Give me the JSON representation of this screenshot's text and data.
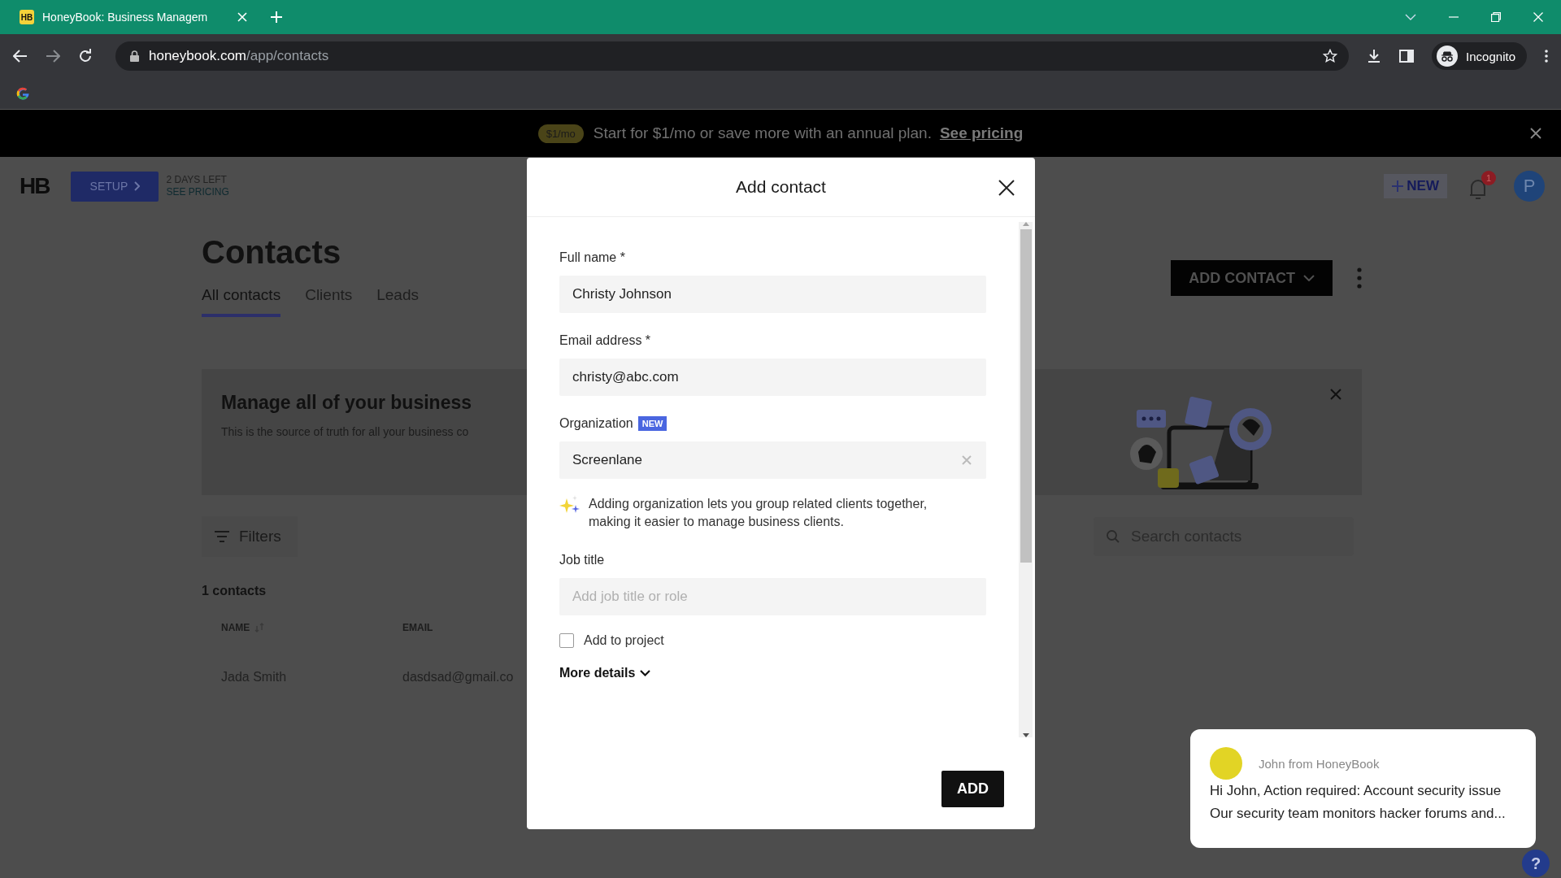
{
  "browser": {
    "favicon": "HB",
    "tab_title": "HoneyBook: Business Managem",
    "url_host": "honeybook.com",
    "url_path": "/app/contacts",
    "profile": "Incognito"
  },
  "banner": {
    "badge": "$1/mo",
    "text": "Start for $1/mo or save more with an annual plan.",
    "link": "See pricing"
  },
  "header": {
    "logo": "HB",
    "setup": "SETUP",
    "trial_days": "2 DAYS LEFT",
    "trial_link": "SEE PRICING",
    "new_button": "NEW",
    "notification_count": "1",
    "avatar_initial": "P"
  },
  "page": {
    "title": "Contacts",
    "tabs": [
      {
        "label": "All contacts",
        "selected": true
      },
      {
        "label": "Clients",
        "selected": false
      },
      {
        "label": "Leads",
        "selected": false
      }
    ],
    "add_contact": "ADD CONTACT",
    "promo": {
      "title": "Manage all of your business",
      "text": "This is the source of truth for all your business co"
    },
    "filters": "Filters",
    "search": {
      "placeholder": "Search contacts"
    },
    "count": "1 contacts",
    "table": {
      "columns": [
        "NAME",
        "EMAIL"
      ],
      "rows": [
        {
          "name": "Jada Smith",
          "email": "dasdsad@gmail.co"
        }
      ]
    }
  },
  "modal": {
    "title": "Add contact",
    "fields": [
      {
        "kind": "text",
        "label": "Full name *",
        "value": "Christy Johnson"
      },
      {
        "kind": "text",
        "label": "Email address *",
        "value": "christy@abc.com"
      },
      {
        "kind": "org",
        "label": "Organization",
        "badge": "NEW",
        "value": "Screenlane",
        "hint": "Adding organization lets you group related clients together, making it easier to manage business clients."
      },
      {
        "kind": "text",
        "label": "Job title",
        "placeholder": "Add job title or role"
      }
    ],
    "add_to_project": {
      "label": "Add to project",
      "checked": false
    },
    "more_details": "More details",
    "submit": "ADD"
  },
  "chat": {
    "sender": "John from HoneyBook",
    "lines": [
      "Hi John, Action required: Account security issue",
      "Our security team monitors hacker forums and..."
    ],
    "help": "?"
  }
}
